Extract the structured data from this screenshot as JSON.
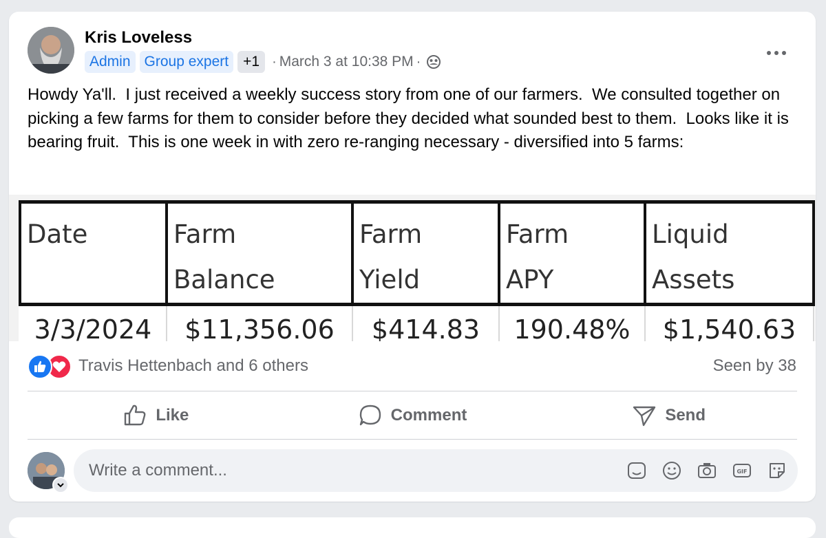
{
  "post": {
    "author": "Kris Loveless",
    "badges": [
      "Admin",
      "Group expert",
      "+1"
    ],
    "timestamp": "March 3 at 10:38 PM",
    "audience_icon": "members-icon",
    "text": "Howdy Ya'll.  I just received a weekly success story from one of our farmers.  We consulted together on picking a few farms for them to consider before they decided what sounded best to them.  Looks like it is bearing fruit.  This is one week in with zero re-ranging necessary - diversified into 5 farms:"
  },
  "table": {
    "headers": [
      [
        "Date",
        ""
      ],
      [
        "Farm",
        "Balance"
      ],
      [
        "Farm",
        "Yield"
      ],
      [
        "Farm",
        "APY"
      ],
      [
        "Liquid",
        "Assets"
      ]
    ],
    "row": [
      "3/3/2024",
      "$11,356.06",
      "$414.83",
      "190.48%",
      "$1,540.63"
    ]
  },
  "reactions": {
    "icons": [
      "like-reaction-icon",
      "love-reaction-icon"
    ],
    "names": "Travis Hettenbach and 6 others",
    "seen": "Seen by 38"
  },
  "actions": {
    "like": "Like",
    "comment": "Comment",
    "send": "Send"
  },
  "comment": {
    "placeholder": "Write a comment...",
    "icons": [
      "sticker-icon",
      "emoji-icon",
      "camera-icon",
      "gif-icon",
      "avatar-sticker-icon"
    ]
  },
  "colors": {
    "accent": "#1877f2",
    "badge_bg": "#e7f0fd",
    "secondary_text": "#65676b",
    "love": "#f0284a"
  }
}
